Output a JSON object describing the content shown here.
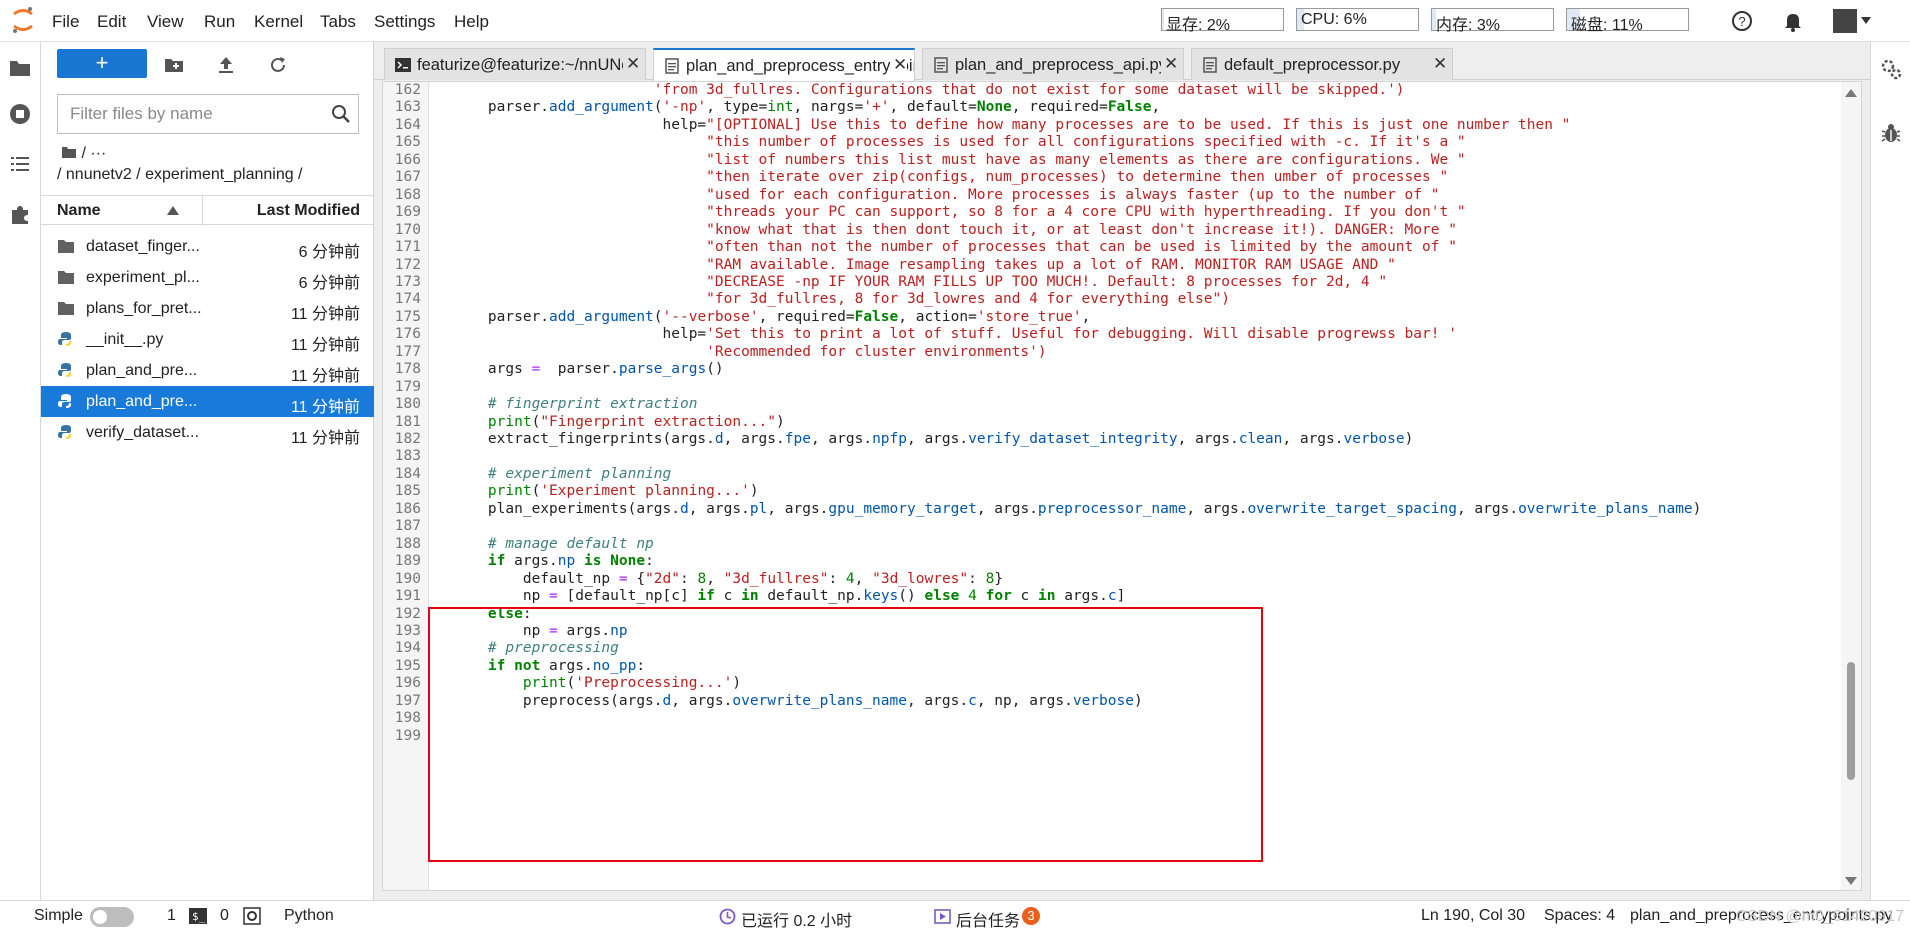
{
  "menubar": {
    "items": [
      "File",
      "Edit",
      "View",
      "Run",
      "Kernel",
      "Tabs",
      "Settings",
      "Help"
    ],
    "resources": [
      {
        "label": "显存: 2%",
        "percent": 2
      },
      {
        "label": "CPU: 6%",
        "percent": 6
      },
      {
        "label": "内存: 3%",
        "percent": 3
      },
      {
        "label": "磁盘: 11%",
        "percent": 11
      }
    ]
  },
  "filebrowser": {
    "new_label": "+",
    "filter_placeholder": "Filter files by name",
    "breadcrumb_root": "/  ···",
    "breadcrumb_path": "/ nnunetv2 / experiment_planning /",
    "col_name": "Name",
    "col_modified": "Last Modified",
    "files": [
      {
        "name": "dataset_finger...",
        "time": "6 分钟前",
        "type": "folder"
      },
      {
        "name": "experiment_pl...",
        "time": "6 分钟前",
        "type": "folder"
      },
      {
        "name": "plans_for_pret...",
        "time": "11 分钟前",
        "type": "folder"
      },
      {
        "name": "__init__.py",
        "time": "11 分钟前",
        "type": "python"
      },
      {
        "name": "plan_and_pre...",
        "time": "11 分钟前",
        "type": "python"
      },
      {
        "name": "plan_and_pre...",
        "time": "11 分钟前",
        "type": "python",
        "selected": true
      },
      {
        "name": "verify_dataset...",
        "time": "11 分钟前",
        "type": "python"
      }
    ]
  },
  "tabs": [
    {
      "label": "featurize@featurize:~/nnUNet",
      "active": false
    },
    {
      "label": "plan_and_preprocess_entrypoints.py",
      "active": true
    },
    {
      "label": "plan_and_preprocess_api.py",
      "active": false
    },
    {
      "label": "default_preprocessor.py",
      "active": false
    }
  ],
  "code": [
    {
      "n": "162",
      "t": [
        [
          "s",
          "                       'from 3d_fullres. Configurations that do not exist for some dataset will be skipped.')"
        ]
      ]
    },
    {
      "n": "163",
      "t": [
        [
          "",
          "    parser."
        ],
        [
          "at",
          "add_argument"
        ],
        [
          "",
          "("
        ],
        [
          "s",
          "'-np'"
        ],
        [
          "",
          ", type="
        ],
        [
          "bn",
          "int"
        ],
        [
          "",
          ", nargs="
        ],
        [
          "s",
          "'+'"
        ],
        [
          "",
          ", default="
        ],
        [
          "kw",
          "None"
        ],
        [
          "",
          ", required="
        ],
        [
          "kw",
          "False"
        ],
        [
          "",
          ","
        ]
      ]
    },
    {
      "n": "164",
      "t": [
        [
          "",
          "                        help="
        ],
        [
          "s",
          "\"[OPTIONAL] Use this to define how many processes are to be used. If this is just one number then \""
        ]
      ]
    },
    {
      "n": "165",
      "t": [
        [
          "s",
          "                             \"this number of processes is used for all configurations specified with -c. If it's a \""
        ]
      ]
    },
    {
      "n": "166",
      "t": [
        [
          "s",
          "                             \"list of numbers this list must have as many elements as there are configurations. We \""
        ]
      ]
    },
    {
      "n": "167",
      "t": [
        [
          "s",
          "                             \"then iterate over zip(configs, num_processes) to determine then umber of processes \""
        ]
      ]
    },
    {
      "n": "168",
      "t": [
        [
          "s",
          "                             \"used for each configuration. More processes is always faster (up to the number of \""
        ]
      ]
    },
    {
      "n": "169",
      "t": [
        [
          "s",
          "                             \"threads your PC can support, so 8 for a 4 core CPU with hyperthreading. If you don't \""
        ]
      ]
    },
    {
      "n": "170",
      "t": [
        [
          "s",
          "                             \"know what that is then dont touch it, or at least don't increase it!). DANGER: More \""
        ]
      ]
    },
    {
      "n": "171",
      "t": [
        [
          "s",
          "                             \"often than not the number of processes that can be used is limited by the amount of \""
        ]
      ]
    },
    {
      "n": "172",
      "t": [
        [
          "s",
          "                             \"RAM available. Image resampling takes up a lot of RAM. MONITOR RAM USAGE AND \""
        ]
      ]
    },
    {
      "n": "173",
      "t": [
        [
          "s",
          "                             \"DECREASE -np IF YOUR RAM FILLS UP TOO MUCH!. Default: 8 processes for 2d, 4 \""
        ]
      ]
    },
    {
      "n": "174",
      "t": [
        [
          "s",
          "                             \"for 3d_fullres, 8 for 3d_lowres and 4 for everything else\")"
        ]
      ]
    },
    {
      "n": "175",
      "t": [
        [
          "",
          "    parser."
        ],
        [
          "at",
          "add_argument"
        ],
        [
          "",
          "("
        ],
        [
          "s",
          "'--verbose'"
        ],
        [
          "",
          ", required="
        ],
        [
          "kw",
          "False"
        ],
        [
          "",
          ", action="
        ],
        [
          "s",
          "'store_true'"
        ],
        [
          "",
          ","
        ]
      ]
    },
    {
      "n": "176",
      "t": [
        [
          "",
          "                        help="
        ],
        [
          "s",
          "'Set this to print a lot of stuff. Useful for debugging. Will disable progrewss bar! '"
        ]
      ]
    },
    {
      "n": "177",
      "t": [
        [
          "s",
          "                             'Recommended for cluster environments')"
        ]
      ]
    },
    {
      "n": "178",
      "t": [
        [
          "",
          "    args "
        ],
        [
          "op",
          "="
        ],
        [
          "",
          "  parser."
        ],
        [
          "at",
          "parse_args"
        ],
        [
          "",
          "()"
        ]
      ]
    },
    {
      "n": "179",
      "t": []
    },
    {
      "n": "180",
      "t": [
        [
          "cm",
          "    # fingerprint extraction"
        ]
      ]
    },
    {
      "n": "181",
      "t": [
        [
          "bn",
          "    print"
        ],
        [
          "",
          "("
        ],
        [
          "s",
          "\"Fingerprint extraction...\""
        ],
        [
          "",
          ")"
        ]
      ]
    },
    {
      "n": "182",
      "t": [
        [
          "",
          "    extract_fingerprints(args."
        ],
        [
          "at",
          "d"
        ],
        [
          "",
          ", args."
        ],
        [
          "at",
          "fpe"
        ],
        [
          "",
          ", args."
        ],
        [
          "at",
          "npfp"
        ],
        [
          "",
          ", args."
        ],
        [
          "at",
          "verify_dataset_integrity"
        ],
        [
          "",
          ", args."
        ],
        [
          "at",
          "clean"
        ],
        [
          "",
          ", args."
        ],
        [
          "at",
          "verbose"
        ],
        [
          "",
          ")"
        ]
      ]
    },
    {
      "n": "183",
      "t": []
    },
    {
      "n": "184",
      "t": [
        [
          "cm",
          "    # experiment planning"
        ]
      ]
    },
    {
      "n": "185",
      "t": [
        [
          "bn",
          "    print"
        ],
        [
          "",
          "("
        ],
        [
          "s",
          "'Experiment planning...'"
        ],
        [
          "",
          ")"
        ]
      ]
    },
    {
      "n": "186",
      "t": [
        [
          "",
          "    plan_experiments(args."
        ],
        [
          "at",
          "d"
        ],
        [
          "",
          ", args."
        ],
        [
          "at",
          "pl"
        ],
        [
          "",
          ", args."
        ],
        [
          "at",
          "gpu_memory_target"
        ],
        [
          "",
          ", args."
        ],
        [
          "at",
          "preprocessor_name"
        ],
        [
          "",
          ", args."
        ],
        [
          "at",
          "overwrite_target_spacing"
        ],
        [
          "",
          ", args."
        ],
        [
          "at",
          "overwrite_plans_name"
        ],
        [
          "",
          ")"
        ]
      ]
    },
    {
      "n": "187",
      "t": []
    },
    {
      "n": "188",
      "t": [
        [
          "cm",
          "    # manage default np"
        ]
      ]
    },
    {
      "n": "189",
      "t": [
        [
          "kw",
          "    if"
        ],
        [
          "",
          " args."
        ],
        [
          "at",
          "np"
        ],
        [
          "",
          ""
        ],
        [
          "kw",
          " is"
        ],
        [
          "kw",
          " None"
        ],
        [
          "",
          ":"
        ]
      ]
    },
    {
      "n": "190",
      "t": [
        [
          "",
          "        default_np "
        ],
        [
          "op",
          "="
        ],
        [
          "",
          " {"
        ],
        [
          "s",
          "\"2d\""
        ],
        [
          "",
          ": "
        ],
        [
          "nm",
          "8"
        ],
        [
          "",
          ", "
        ],
        [
          "s",
          "\"3d_fullres\""
        ],
        [
          "",
          ": "
        ],
        [
          "nm",
          "4"
        ],
        [
          "",
          ", "
        ],
        [
          "s",
          "\"3d_lowres\""
        ],
        [
          "",
          ": "
        ],
        [
          "nm",
          "8"
        ],
        [
          "",
          "}"
        ]
      ]
    },
    {
      "n": "191",
      "t": [
        [
          "",
          "        np "
        ],
        [
          "op",
          "="
        ],
        [
          "",
          " [default_np[c] "
        ],
        [
          "kw",
          "if"
        ],
        [
          "",
          " c "
        ],
        [
          "kw",
          "in"
        ],
        [
          "",
          " default_np."
        ],
        [
          "at",
          "keys"
        ],
        [
          "",
          "() "
        ],
        [
          "kw",
          "else"
        ],
        [
          "",
          " "
        ],
        [
          "nm",
          "4"
        ],
        [
          "",
          " "
        ],
        [
          "kw",
          "for"
        ],
        [
          "",
          " c "
        ],
        [
          "kw",
          "in"
        ],
        [
          "",
          " args."
        ],
        [
          "at",
          "c"
        ],
        [
          "",
          "]"
        ]
      ]
    },
    {
      "n": "192",
      "t": [
        [
          "kw",
          "    else"
        ],
        [
          "",
          ":"
        ]
      ]
    },
    {
      "n": "193",
      "t": [
        [
          "",
          "        np "
        ],
        [
          "op",
          "="
        ],
        [
          "",
          " args."
        ],
        [
          "at",
          "np"
        ]
      ]
    },
    {
      "n": "194",
      "t": [
        [
          "cm",
          "    # preprocessing"
        ]
      ]
    },
    {
      "n": "195",
      "t": [
        [
          "kw",
          "    if not"
        ],
        [
          "",
          " args."
        ],
        [
          "at",
          "no_pp"
        ],
        [
          "",
          ":"
        ]
      ]
    },
    {
      "n": "196",
      "t": [
        [
          "bn",
          "        print"
        ],
        [
          "",
          "("
        ],
        [
          "s",
          "'Preprocessing...'"
        ],
        [
          "",
          ")"
        ]
      ]
    },
    {
      "n": "197",
      "t": [
        [
          "",
          "        preprocess(args."
        ],
        [
          "at",
          "d"
        ],
        [
          "",
          ", args."
        ],
        [
          "at",
          "overwrite_plans_name"
        ],
        [
          "",
          ", args."
        ],
        [
          "at",
          "c"
        ],
        [
          "",
          ", np, args."
        ],
        [
          "at",
          "verbose"
        ],
        [
          "",
          ")"
        ]
      ]
    },
    {
      "n": "198",
      "t": []
    },
    {
      "n": "199",
      "t": []
    }
  ],
  "statusbar": {
    "mode": "Simple",
    "terminals": "1",
    "kernels": "0",
    "kernel_name": "Python",
    "uptime": "已运行 0.2 小时",
    "bg_tasks": "后台任务",
    "bg_count": "3",
    "cursor": "Ln 190, Col 30",
    "spaces": "Spaces: 4",
    "filename": "plan_and_preprocess_entrypoints.py",
    "watermark": "CSDN @m0_61420917"
  },
  "colors": {
    "accent": "#1976d2",
    "highlight_box": "#e60012",
    "badge": "#e8601c"
  }
}
